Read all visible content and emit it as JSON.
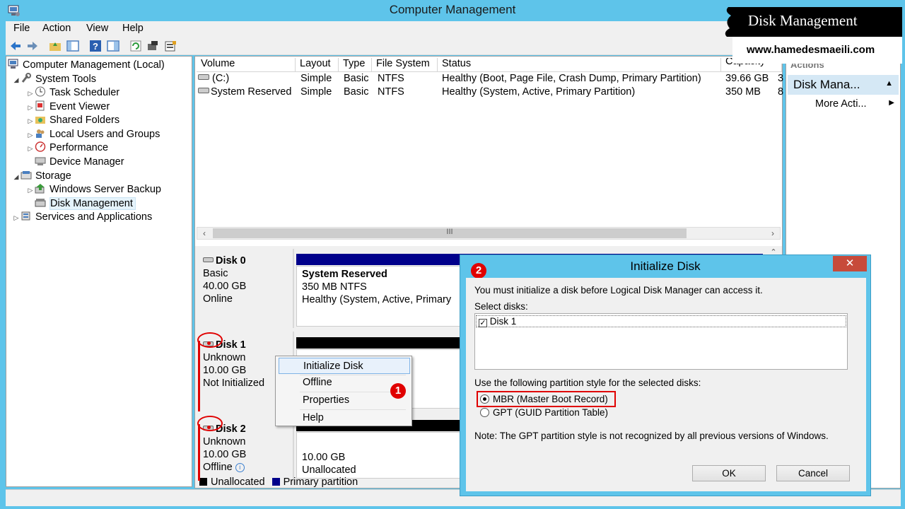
{
  "window": {
    "title": "Computer Management"
  },
  "menu": [
    "File",
    "Action",
    "View",
    "Help"
  ],
  "watermark": {
    "title": "Disk Management",
    "url": "www.hamedesmaeili.com"
  },
  "tree": {
    "root": "Computer Management (Local)",
    "system_tools": "System Tools",
    "task_scheduler": "Task Scheduler",
    "event_viewer": "Event Viewer",
    "shared_folders": "Shared Folders",
    "local_users": "Local Users and Groups",
    "performance": "Performance",
    "device_manager": "Device Manager",
    "storage": "Storage",
    "wsb": "Windows Server Backup",
    "disk_management": "Disk Management",
    "services": "Services and Applications"
  },
  "volumes": {
    "headers": [
      "Volume",
      "Layout",
      "Type",
      "File System",
      "Status",
      "Capacity"
    ],
    "rows": [
      {
        "volume": "(C:)",
        "layout": "Simple",
        "type": "Basic",
        "fs": "NTFS",
        "status": "Healthy (Boot, Page File, Crash Dump, Primary Partition)",
        "capacity": "39.66 GB",
        "extra": "3"
      },
      {
        "volume": "System Reserved",
        "layout": "Simple",
        "type": "Basic",
        "fs": "NTFS",
        "status": "Healthy (System, Active, Primary Partition)",
        "capacity": "350 MB",
        "extra": "8"
      }
    ],
    "scroll_grip": "III"
  },
  "disks": {
    "disk0": {
      "name": "Disk 0",
      "type": "Basic",
      "size": "40.00 GB",
      "state": "Online",
      "part_title": "System Reserved",
      "part_size": "350 MB NTFS",
      "part_status": "Healthy (System, Active, Primary"
    },
    "disk1": {
      "name": "Disk 1",
      "type": "Unknown",
      "size": "10.00 GB",
      "state": "Not Initialized"
    },
    "disk2": {
      "name": "Disk 2",
      "type": "Unknown",
      "size": "10.00 GB",
      "state": "Offline",
      "part_size": "10.00 GB",
      "part_status": "Unallocated"
    }
  },
  "legend": {
    "unallocated": "Unallocated",
    "primary": "Primary partition"
  },
  "actions": {
    "header": "Actions",
    "section": "Disk Mana...",
    "more": "More Acti..."
  },
  "context_menu": [
    "Initialize Disk",
    "Offline",
    "Properties",
    "Help"
  ],
  "badges": {
    "one": "1",
    "two": "2"
  },
  "dialog": {
    "title": "Initialize Disk",
    "close": "✕",
    "intro": "You must initialize a disk before Logical Disk Manager can access it.",
    "select_label": "Select disks:",
    "disk_item": "Disk 1",
    "style_label": "Use the following partition style for the selected disks:",
    "mbr": "MBR (Master Boot Record)",
    "gpt": "GPT (GUID Partition Table)",
    "note": "Note: The GPT partition style is not recognized by all previous versions of Windows.",
    "ok": "OK",
    "cancel": "Cancel"
  },
  "colors": {
    "accent": "#5ec4ea",
    "primary_partition": "#00008b",
    "highlight_red": "#e00000"
  }
}
